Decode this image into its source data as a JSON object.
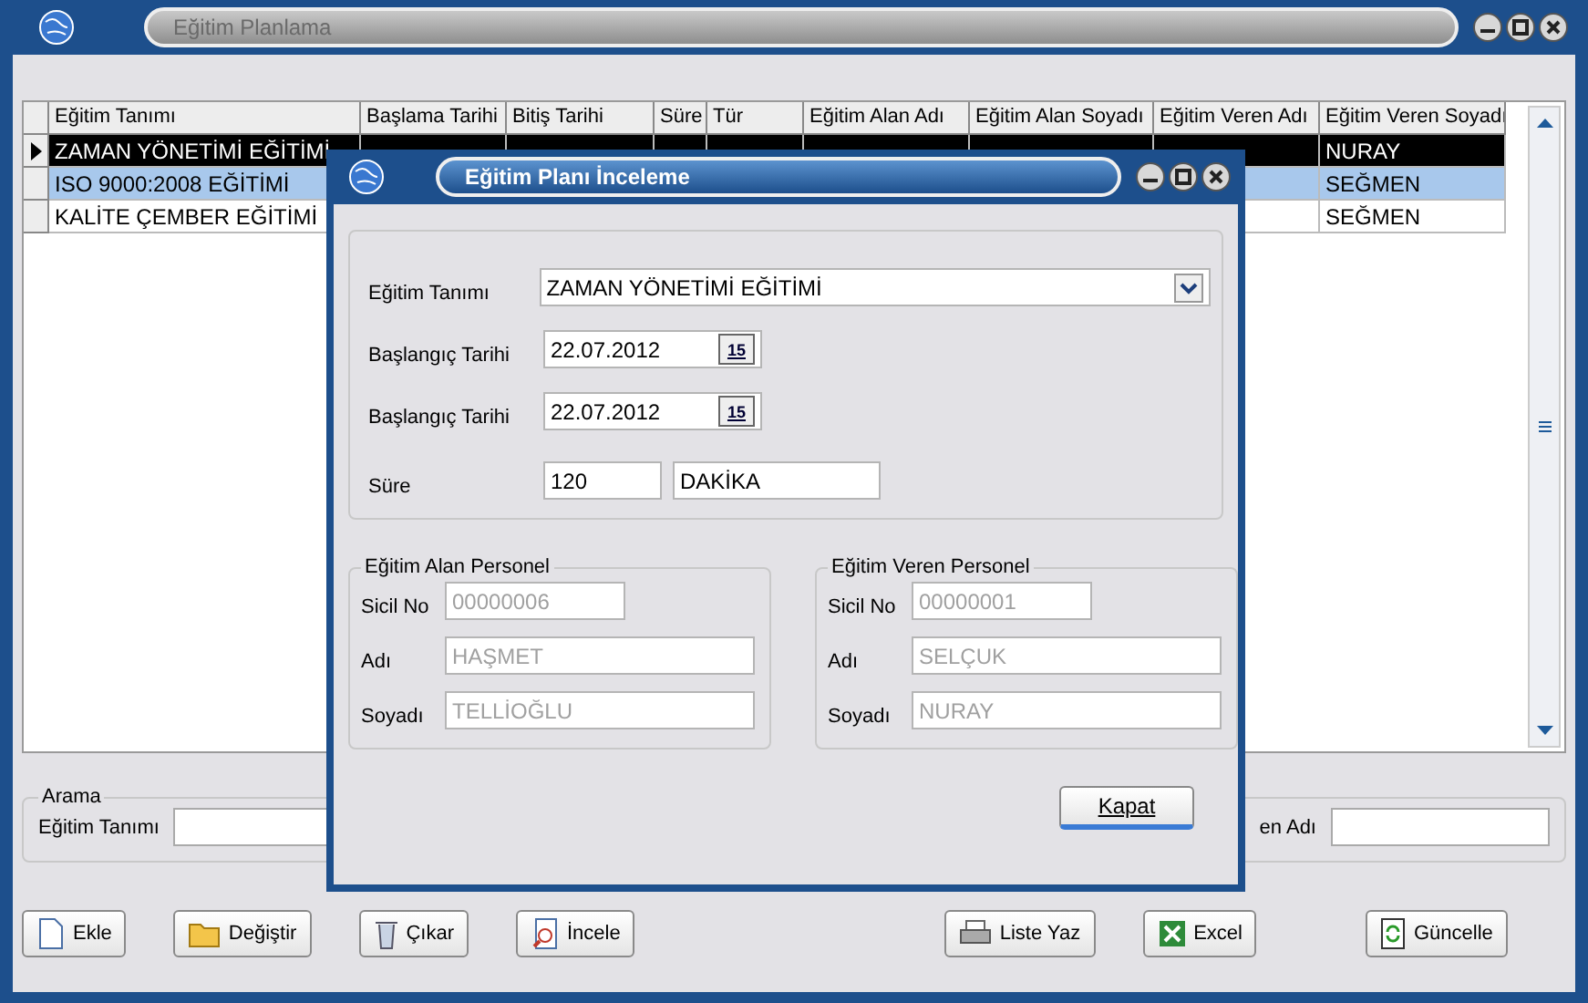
{
  "window": {
    "title": "Eğitim Planlama"
  },
  "table": {
    "columns": [
      "Eğitim Tanımı",
      "Başlama Tarihi",
      "Bitiş Tarihi",
      "Süre",
      "Tür",
      "Eğitim Alan Adı",
      "Eğitim Alan Soyadı",
      "Eğitim Veren Adı",
      "Eğitim Veren Soyadı"
    ],
    "rows": [
      {
        "current": true,
        "focused": true,
        "selected": false,
        "cells": [
          "ZAMAN YÖNETİMİ EĞİTİMİ",
          null,
          null,
          null,
          null,
          null,
          null,
          null,
          "NURAY"
        ]
      },
      {
        "current": false,
        "focused": false,
        "selected": true,
        "cells": [
          "ISO 9000:2008 EĞİTİMİ",
          null,
          null,
          null,
          null,
          null,
          null,
          null,
          "SEĞMEN"
        ]
      },
      {
        "current": false,
        "focused": false,
        "selected": false,
        "cells": [
          "KALİTE ÇEMBER EĞİTİMİ",
          null,
          null,
          null,
          null,
          null,
          null,
          null,
          "SEĞMEN"
        ]
      }
    ]
  },
  "search": {
    "title": "Arama",
    "fields": [
      {
        "label": "Eğitim Tanımı"
      },
      {
        "label": "en Adı"
      }
    ]
  },
  "buttons": [
    "Ekle",
    "Değiştir",
    "Çıkar",
    "İncele",
    "Liste Yaz",
    "Excel",
    "Güncelle"
  ],
  "dialog": {
    "title": "Eğitim Planı İnceleme",
    "form": [
      {
        "kind": "combo",
        "label": "Eğitim Tanımı",
        "value": "ZAMAN YÖNETİMİ EĞİTİMİ"
      },
      {
        "kind": "date",
        "label": "Başlangıç Tarihi",
        "value": "22.07.2012",
        "picker": "15"
      },
      {
        "kind": "date",
        "label": "Başlangıç Tarihi",
        "value": "22.07.2012",
        "picker": "15"
      },
      {
        "kind": "pair",
        "label": "Süre",
        "value": "120",
        "unit": "DAKİKA"
      }
    ],
    "groups": [
      {
        "title": "Eğitim Alan Personel",
        "fields": [
          {
            "label": "Sicil No",
            "value": "00000006",
            "disabled": true
          },
          {
            "label": "Adı",
            "value": "HAŞMET",
            "disabled": true
          },
          {
            "label": "Soyadı",
            "value": "TELLİOĞLU",
            "disabled": true
          }
        ]
      },
      {
        "title": "Eğitim Veren Personel",
        "fields": [
          {
            "label": "Sicil No",
            "value": "00000001",
            "disabled": true
          },
          {
            "label": "Adı",
            "value": "SELÇUK",
            "disabled": true
          },
          {
            "label": "Soyadı",
            "value": "NURAY",
            "disabled": true
          }
        ]
      }
    ],
    "close_button": "Kapat"
  }
}
